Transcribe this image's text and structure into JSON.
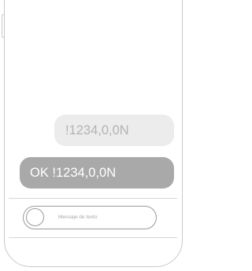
{
  "conversation": {
    "messages": [
      {
        "direction": "sent",
        "text": "!1234,0,0N"
      },
      {
        "direction": "received",
        "text": "OK !1234,0,0N"
      }
    ]
  },
  "composer": {
    "placeholder": "Mensaje de texto",
    "attach_icon": "circle-icon"
  },
  "colors": {
    "sent_bubble": "#ececec",
    "sent_text": "#b3b3b3",
    "received_bubble": "#a9a9a9",
    "received_text": "#ffffff",
    "frame_outline": "#c9c9c9"
  }
}
